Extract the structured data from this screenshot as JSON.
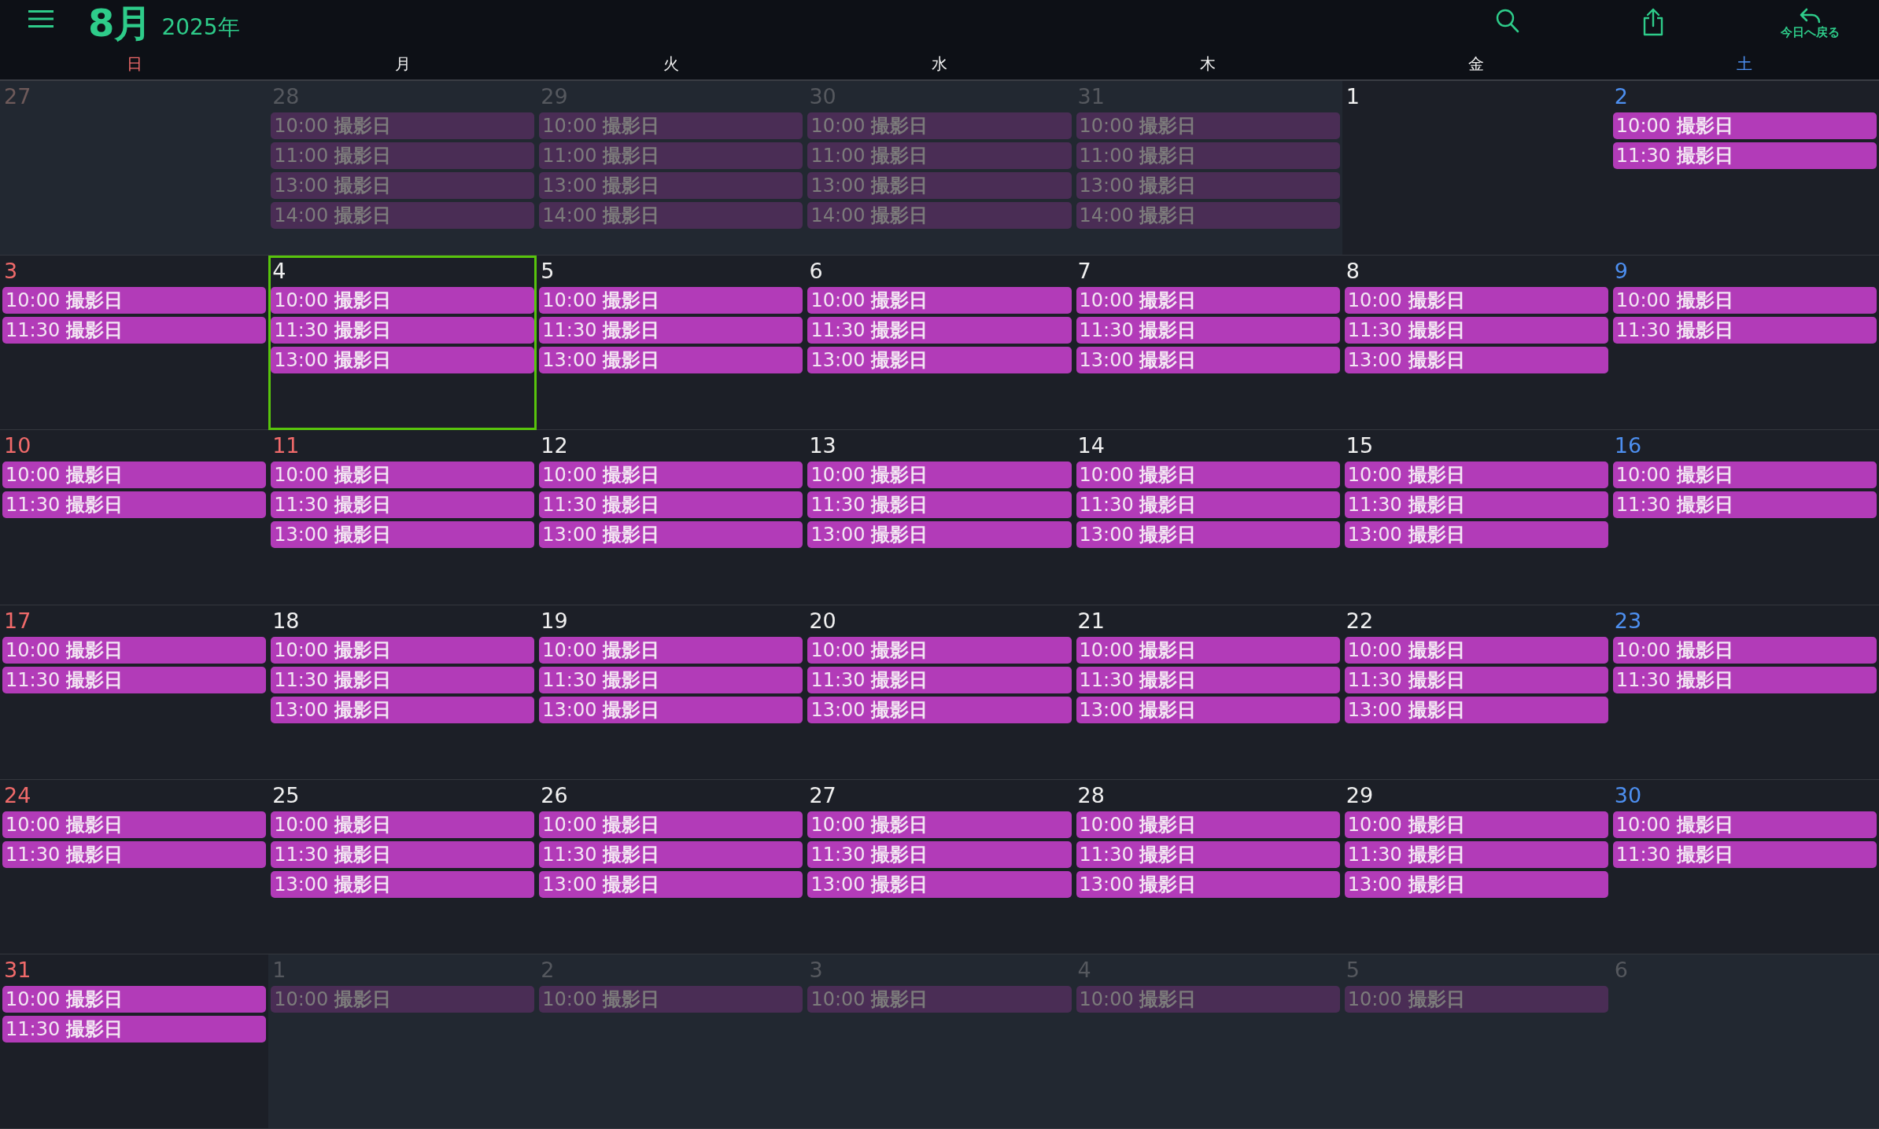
{
  "toolbar": {
    "month": "8月",
    "year": "2025年",
    "today_button": "今日へ戻る"
  },
  "weekdays": [
    {
      "label": "日",
      "kind": "sunday"
    },
    {
      "label": "月",
      "kind": "weekday"
    },
    {
      "label": "火",
      "kind": "weekday"
    },
    {
      "label": "水",
      "kind": "weekday"
    },
    {
      "label": "木",
      "kind": "weekday"
    },
    {
      "label": "金",
      "kind": "weekday"
    },
    {
      "label": "土",
      "kind": "saturday"
    }
  ],
  "weeks": [
    [
      {
        "date": "27",
        "outside": true,
        "holiday": true,
        "selected": false
      },
      {
        "date": "28",
        "outside": true,
        "holiday": false,
        "selected": false,
        "events": [
          {
            "time": "10:00",
            "title": "撮影日"
          },
          {
            "time": "11:00",
            "title": "撮影日"
          },
          {
            "time": "13:00",
            "title": "撮影日"
          },
          {
            "time": "14:00",
            "title": "撮影日"
          }
        ]
      },
      {
        "date": "29",
        "outside": true,
        "holiday": false,
        "selected": false,
        "events": [
          {
            "time": "10:00",
            "title": "撮影日"
          },
          {
            "time": "11:00",
            "title": "撮影日"
          },
          {
            "time": "13:00",
            "title": "撮影日"
          },
          {
            "time": "14:00",
            "title": "撮影日"
          }
        ]
      },
      {
        "date": "30",
        "outside": true,
        "holiday": false,
        "selected": false,
        "events": [
          {
            "time": "10:00",
            "title": "撮影日"
          },
          {
            "time": "11:00",
            "title": "撮影日"
          },
          {
            "time": "13:00",
            "title": "撮影日"
          },
          {
            "time": "14:00",
            "title": "撮影日"
          }
        ]
      },
      {
        "date": "31",
        "outside": true,
        "holiday": false,
        "selected": false,
        "events": [
          {
            "time": "10:00",
            "title": "撮影日"
          },
          {
            "time": "11:00",
            "title": "撮影日"
          },
          {
            "time": "13:00",
            "title": "撮影日"
          },
          {
            "time": "14:00",
            "title": "撮影日"
          }
        ]
      },
      {
        "date": "1",
        "outside": false,
        "holiday": false,
        "selected": false
      },
      {
        "date": "2",
        "outside": false,
        "holiday": false,
        "selected": false,
        "events": [
          {
            "time": "10:00",
            "title": "撮影日"
          },
          {
            "time": "11:30",
            "title": "撮影日"
          }
        ]
      }
    ],
    [
      {
        "date": "3",
        "outside": false,
        "holiday": true,
        "selected": false,
        "events": [
          {
            "time": "10:00",
            "title": "撮影日"
          },
          {
            "time": "11:30",
            "title": "撮影日"
          }
        ]
      },
      {
        "date": "4",
        "outside": false,
        "holiday": false,
        "selected": true,
        "events": [
          {
            "time": "10:00",
            "title": "撮影日"
          },
          {
            "time": "11:30",
            "title": "撮影日"
          },
          {
            "time": "13:00",
            "title": "撮影日"
          }
        ]
      },
      {
        "date": "5",
        "outside": false,
        "holiday": false,
        "selected": false,
        "events": [
          {
            "time": "10:00",
            "title": "撮影日"
          },
          {
            "time": "11:30",
            "title": "撮影日"
          },
          {
            "time": "13:00",
            "title": "撮影日"
          }
        ]
      },
      {
        "date": "6",
        "outside": false,
        "holiday": false,
        "selected": false,
        "events": [
          {
            "time": "10:00",
            "title": "撮影日"
          },
          {
            "time": "11:30",
            "title": "撮影日"
          },
          {
            "time": "13:00",
            "title": "撮影日"
          }
        ]
      },
      {
        "date": "7",
        "outside": false,
        "holiday": false,
        "selected": false,
        "events": [
          {
            "time": "10:00",
            "title": "撮影日"
          },
          {
            "time": "11:30",
            "title": "撮影日"
          },
          {
            "time": "13:00",
            "title": "撮影日"
          }
        ]
      },
      {
        "date": "8",
        "outside": false,
        "holiday": false,
        "selected": false,
        "events": [
          {
            "time": "10:00",
            "title": "撮影日"
          },
          {
            "time": "11:30",
            "title": "撮影日"
          },
          {
            "time": "13:00",
            "title": "撮影日"
          }
        ]
      },
      {
        "date": "9",
        "outside": false,
        "holiday": false,
        "selected": false,
        "events": [
          {
            "time": "10:00",
            "title": "撮影日"
          },
          {
            "time": "11:30",
            "title": "撮影日"
          }
        ]
      }
    ],
    [
      {
        "date": "10",
        "outside": false,
        "holiday": true,
        "selected": false,
        "events": [
          {
            "time": "10:00",
            "title": "撮影日"
          },
          {
            "time": "11:30",
            "title": "撮影日"
          }
        ]
      },
      {
        "date": "11",
        "outside": false,
        "holiday": true,
        "selected": false,
        "events": [
          {
            "time": "10:00",
            "title": "撮影日"
          },
          {
            "time": "11:30",
            "title": "撮影日"
          },
          {
            "time": "13:00",
            "title": "撮影日"
          }
        ]
      },
      {
        "date": "12",
        "outside": false,
        "holiday": false,
        "selected": false,
        "events": [
          {
            "time": "10:00",
            "title": "撮影日"
          },
          {
            "time": "11:30",
            "title": "撮影日"
          },
          {
            "time": "13:00",
            "title": "撮影日"
          }
        ]
      },
      {
        "date": "13",
        "outside": false,
        "holiday": false,
        "selected": false,
        "events": [
          {
            "time": "10:00",
            "title": "撮影日"
          },
          {
            "time": "11:30",
            "title": "撮影日"
          },
          {
            "time": "13:00",
            "title": "撮影日"
          }
        ]
      },
      {
        "date": "14",
        "outside": false,
        "holiday": false,
        "selected": false,
        "events": [
          {
            "time": "10:00",
            "title": "撮影日"
          },
          {
            "time": "11:30",
            "title": "撮影日"
          },
          {
            "time": "13:00",
            "title": "撮影日"
          }
        ]
      },
      {
        "date": "15",
        "outside": false,
        "holiday": false,
        "selected": false,
        "events": [
          {
            "time": "10:00",
            "title": "撮影日"
          },
          {
            "time": "11:30",
            "title": "撮影日"
          },
          {
            "time": "13:00",
            "title": "撮影日"
          }
        ]
      },
      {
        "date": "16",
        "outside": false,
        "holiday": false,
        "selected": false,
        "events": [
          {
            "time": "10:00",
            "title": "撮影日"
          },
          {
            "time": "11:30",
            "title": "撮影日"
          }
        ]
      }
    ],
    [
      {
        "date": "17",
        "outside": false,
        "holiday": true,
        "selected": false,
        "events": [
          {
            "time": "10:00",
            "title": "撮影日"
          },
          {
            "time": "11:30",
            "title": "撮影日"
          }
        ]
      },
      {
        "date": "18",
        "outside": false,
        "holiday": false,
        "selected": false,
        "events": [
          {
            "time": "10:00",
            "title": "撮影日"
          },
          {
            "time": "11:30",
            "title": "撮影日"
          },
          {
            "time": "13:00",
            "title": "撮影日"
          }
        ]
      },
      {
        "date": "19",
        "outside": false,
        "holiday": false,
        "selected": false,
        "events": [
          {
            "time": "10:00",
            "title": "撮影日"
          },
          {
            "time": "11:30",
            "title": "撮影日"
          },
          {
            "time": "13:00",
            "title": "撮影日"
          }
        ]
      },
      {
        "date": "20",
        "outside": false,
        "holiday": false,
        "selected": false,
        "events": [
          {
            "time": "10:00",
            "title": "撮影日"
          },
          {
            "time": "11:30",
            "title": "撮影日"
          },
          {
            "time": "13:00",
            "title": "撮影日"
          }
        ]
      },
      {
        "date": "21",
        "outside": false,
        "holiday": false,
        "selected": false,
        "events": [
          {
            "time": "10:00",
            "title": "撮影日"
          },
          {
            "time": "11:30",
            "title": "撮影日"
          },
          {
            "time": "13:00",
            "title": "撮影日"
          }
        ]
      },
      {
        "date": "22",
        "outside": false,
        "holiday": false,
        "selected": false,
        "events": [
          {
            "time": "10:00",
            "title": "撮影日"
          },
          {
            "time": "11:30",
            "title": "撮影日"
          },
          {
            "time": "13:00",
            "title": "撮影日"
          }
        ]
      },
      {
        "date": "23",
        "outside": false,
        "holiday": false,
        "selected": false,
        "events": [
          {
            "time": "10:00",
            "title": "撮影日"
          },
          {
            "time": "11:30",
            "title": "撮影日"
          }
        ]
      }
    ],
    [
      {
        "date": "24",
        "outside": false,
        "holiday": true,
        "selected": false,
        "events": [
          {
            "time": "10:00",
            "title": "撮影日"
          },
          {
            "time": "11:30",
            "title": "撮影日"
          }
        ]
      },
      {
        "date": "25",
        "outside": false,
        "holiday": false,
        "selected": false,
        "events": [
          {
            "time": "10:00",
            "title": "撮影日"
          },
          {
            "time": "11:30",
            "title": "撮影日"
          },
          {
            "time": "13:00",
            "title": "撮影日"
          }
        ]
      },
      {
        "date": "26",
        "outside": false,
        "holiday": false,
        "selected": false,
        "events": [
          {
            "time": "10:00",
            "title": "撮影日"
          },
          {
            "time": "11:30",
            "title": "撮影日"
          },
          {
            "time": "13:00",
            "title": "撮影日"
          }
        ]
      },
      {
        "date": "27",
        "outside": false,
        "holiday": false,
        "selected": false,
        "events": [
          {
            "time": "10:00",
            "title": "撮影日"
          },
          {
            "time": "11:30",
            "title": "撮影日"
          },
          {
            "time": "13:00",
            "title": "撮影日"
          }
        ]
      },
      {
        "date": "28",
        "outside": false,
        "holiday": false,
        "selected": false,
        "events": [
          {
            "time": "10:00",
            "title": "撮影日"
          },
          {
            "time": "11:30",
            "title": "撮影日"
          },
          {
            "time": "13:00",
            "title": "撮影日"
          }
        ]
      },
      {
        "date": "29",
        "outside": false,
        "holiday": false,
        "selected": false,
        "events": [
          {
            "time": "10:00",
            "title": "撮影日"
          },
          {
            "time": "11:30",
            "title": "撮影日"
          },
          {
            "time": "13:00",
            "title": "撮影日"
          }
        ]
      },
      {
        "date": "30",
        "outside": false,
        "holiday": false,
        "selected": false,
        "events": [
          {
            "time": "10:00",
            "title": "撮影日"
          },
          {
            "time": "11:30",
            "title": "撮影日"
          }
        ]
      }
    ],
    [
      {
        "date": "31",
        "outside": false,
        "holiday": true,
        "selected": false,
        "events": [
          {
            "time": "10:00",
            "title": "撮影日"
          },
          {
            "time": "11:30",
            "title": "撮影日"
          }
        ]
      },
      {
        "date": "1",
        "outside": true,
        "holiday": false,
        "selected": false,
        "events": [
          {
            "time": "10:00",
            "title": "撮影日"
          }
        ]
      },
      {
        "date": "2",
        "outside": true,
        "holiday": false,
        "selected": false,
        "events": [
          {
            "time": "10:00",
            "title": "撮影日"
          }
        ]
      },
      {
        "date": "3",
        "outside": true,
        "holiday": false,
        "selected": false,
        "events": [
          {
            "time": "10:00",
            "title": "撮影日"
          }
        ]
      },
      {
        "date": "4",
        "outside": true,
        "holiday": false,
        "selected": false,
        "events": [
          {
            "time": "10:00",
            "title": "撮影日"
          }
        ]
      },
      {
        "date": "5",
        "outside": true,
        "holiday": false,
        "selected": false,
        "events": [
          {
            "time": "10:00",
            "title": "撮影日"
          }
        ]
      },
      {
        "date": "6",
        "outside": true,
        "holiday": false,
        "selected": false
      }
    ]
  ]
}
